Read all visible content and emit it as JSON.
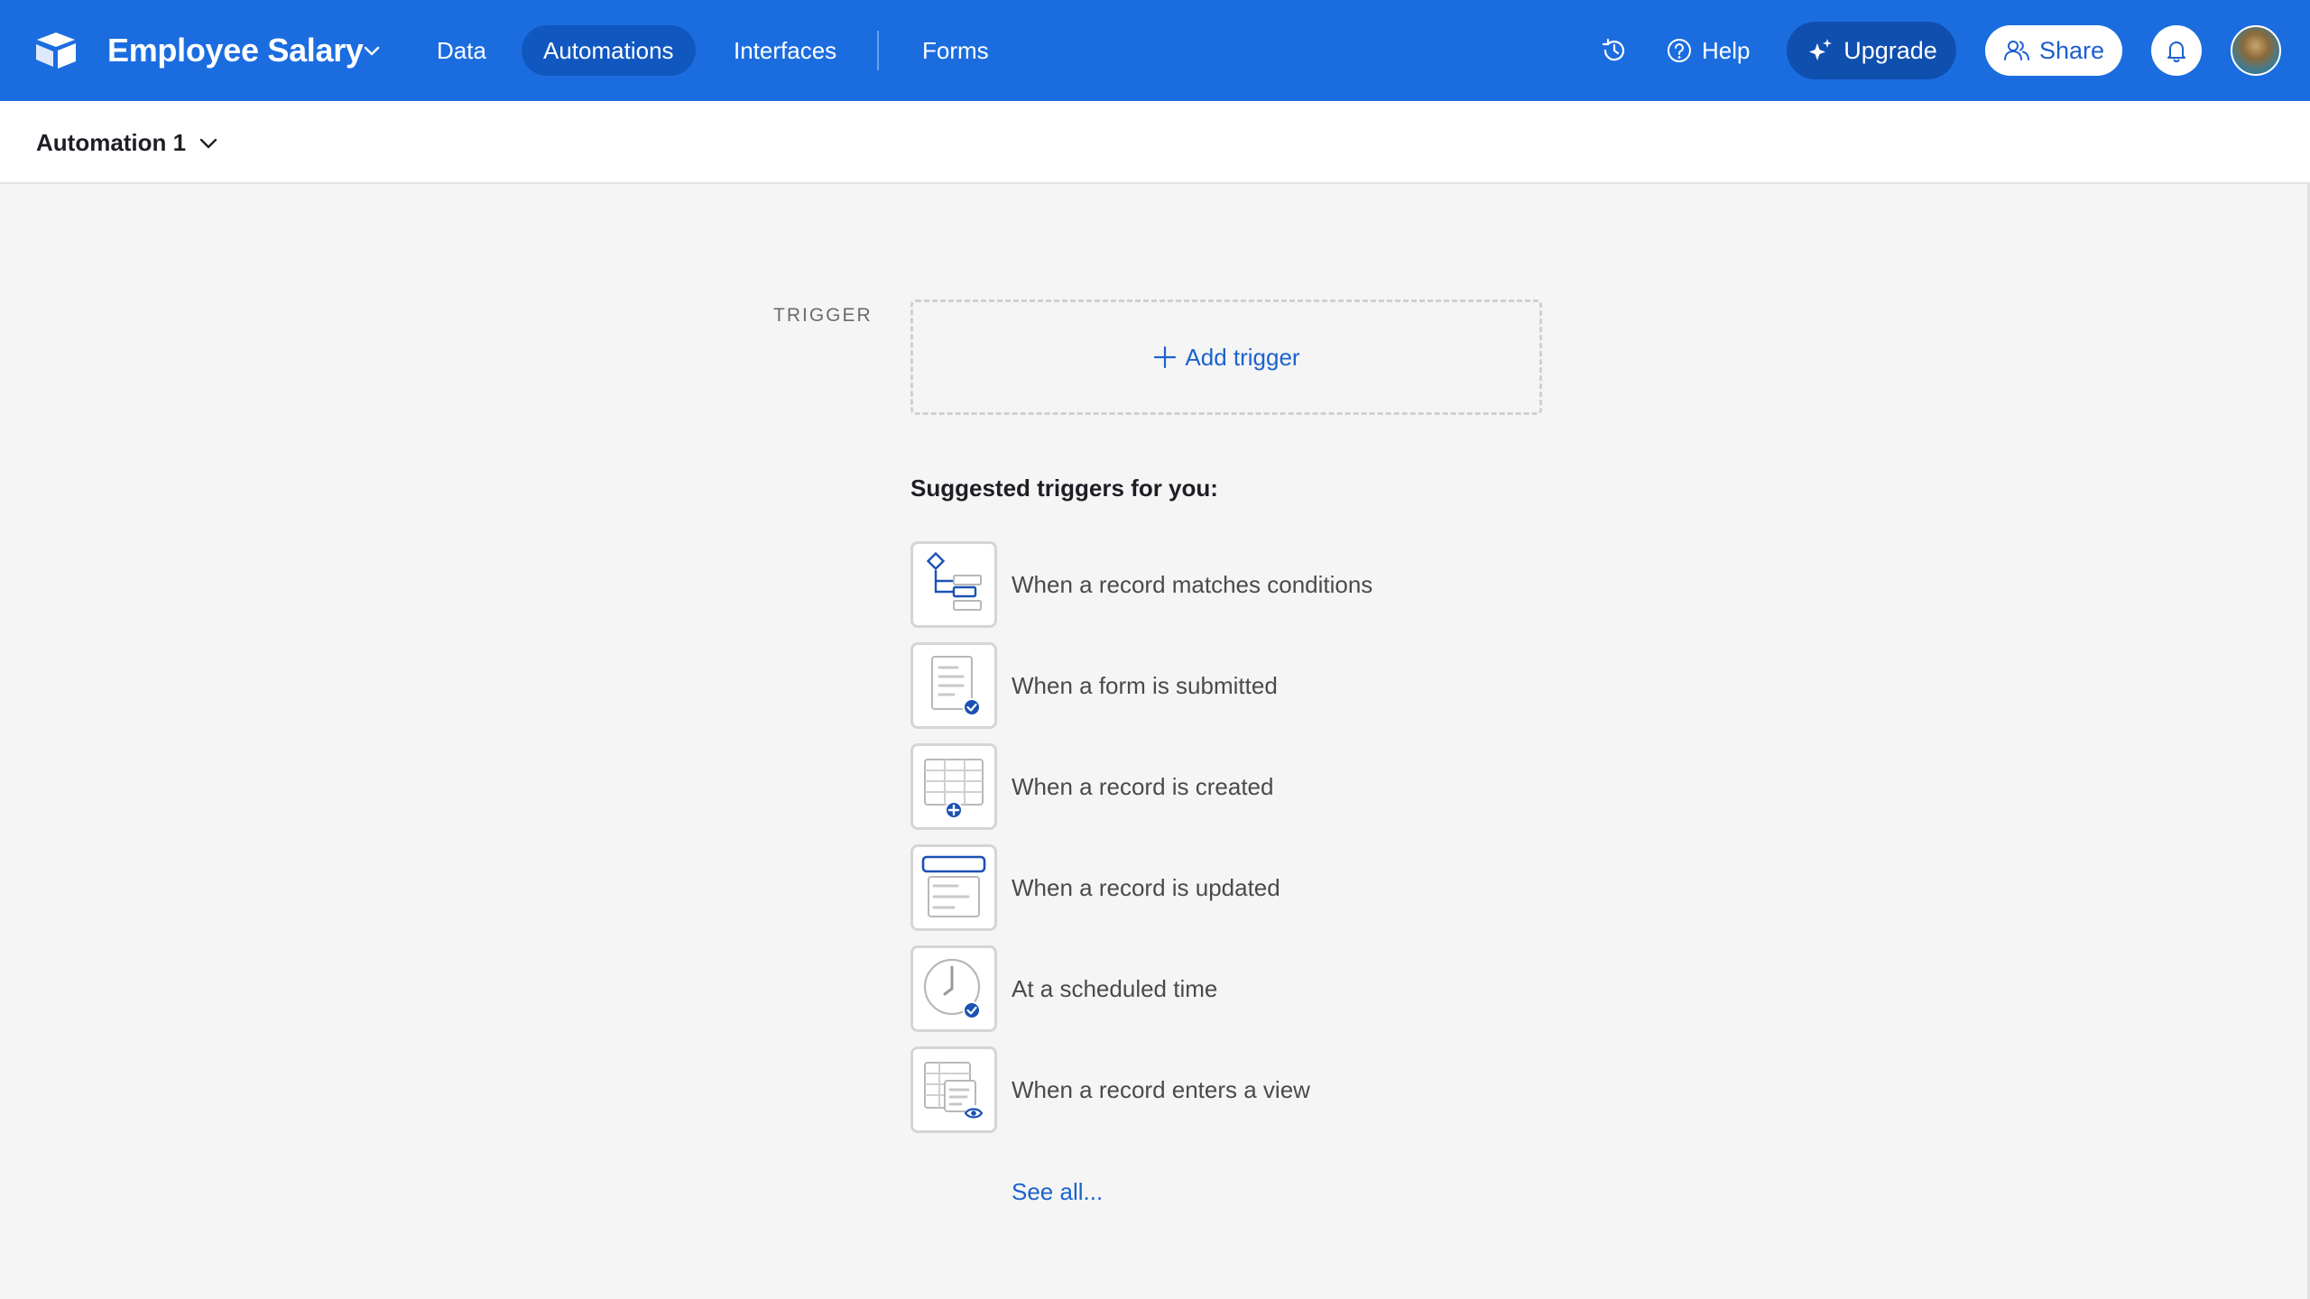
{
  "header": {
    "base_title": "Employee Salary",
    "nav": [
      "Data",
      "Automations",
      "Interfaces",
      "Forms"
    ],
    "active_nav": "Automations",
    "help_label": "Help",
    "upgrade_label": "Upgrade",
    "share_label": "Share"
  },
  "subbar": {
    "automation_name": "Automation 1"
  },
  "main": {
    "trigger_label": "TRIGGER",
    "add_trigger_label": "Add trigger",
    "suggested_title": "Suggested triggers for you:",
    "suggestions": [
      {
        "label": "When a record matches conditions",
        "icon": "conditions-icon"
      },
      {
        "label": "When a form is submitted",
        "icon": "form-submitted-icon"
      },
      {
        "label": "When a record is created",
        "icon": "record-created-icon"
      },
      {
        "label": "When a record is updated",
        "icon": "record-updated-icon"
      },
      {
        "label": "At a scheduled time",
        "icon": "scheduled-time-icon"
      },
      {
        "label": "When a record enters a view",
        "icon": "record-enters-view-icon"
      }
    ],
    "see_all_label": "See all..."
  },
  "colors": {
    "topbar": "#1b6ddf",
    "active_nav": "#1157c0",
    "upgrade_bg": "#0f4fae",
    "link_blue": "#1b62cf"
  }
}
